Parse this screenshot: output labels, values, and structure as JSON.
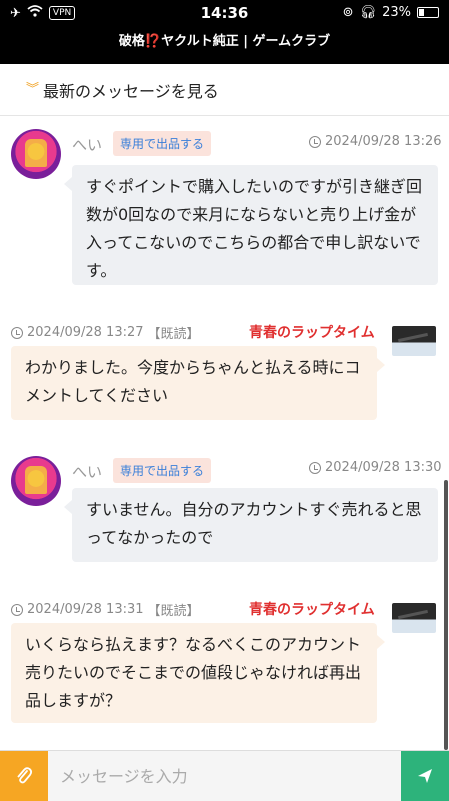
{
  "status_bar": {
    "vpn": "VPN",
    "time": "14:36",
    "battery": "23%"
  },
  "title_bar": {
    "prefix": "破格",
    "question_mark": "⁉️",
    "suffix": "ヤクルト純正 | ゲームクラブ"
  },
  "latest_link": {
    "label": "最新のメッセージを見る"
  },
  "messages": [
    {
      "name": "へい",
      "tag": "専用で出品する",
      "time": "2024/09/28 13:26",
      "text": "すぐポイントで購入したいのですが引き継ぎ回数が0回なので来月にならないと売り上げ金が入ってこないのでこちらの都合で申し訳ないです。"
    },
    {
      "time": "2024/09/28 13:27",
      "read": "【既読】",
      "sender": "青春のラップタイム",
      "text": "わかりました。今度からちゃんと払える時にコメントしてください"
    },
    {
      "name": "へい",
      "tag": "専用で出品する",
      "time": "2024/09/28 13:30",
      "text": "すいません。自分のアカウントすぐ売れると思ってなかったので"
    },
    {
      "time": "2024/09/28 13:31",
      "read": "【既読】",
      "sender": "青春のラップタイム",
      "text": "いくらなら払えます？なるべくこのアカウント売りたいのでそこまでの値段じゃなければ再出品しますが？"
    }
  ],
  "input_bar": {
    "placeholder": "メッセージを入力"
  },
  "colors": {
    "accent_orange": "#f6a623",
    "send_green": "#2db37b",
    "sender_red": "#e03030",
    "tag_blue": "#3a7fd9"
  }
}
